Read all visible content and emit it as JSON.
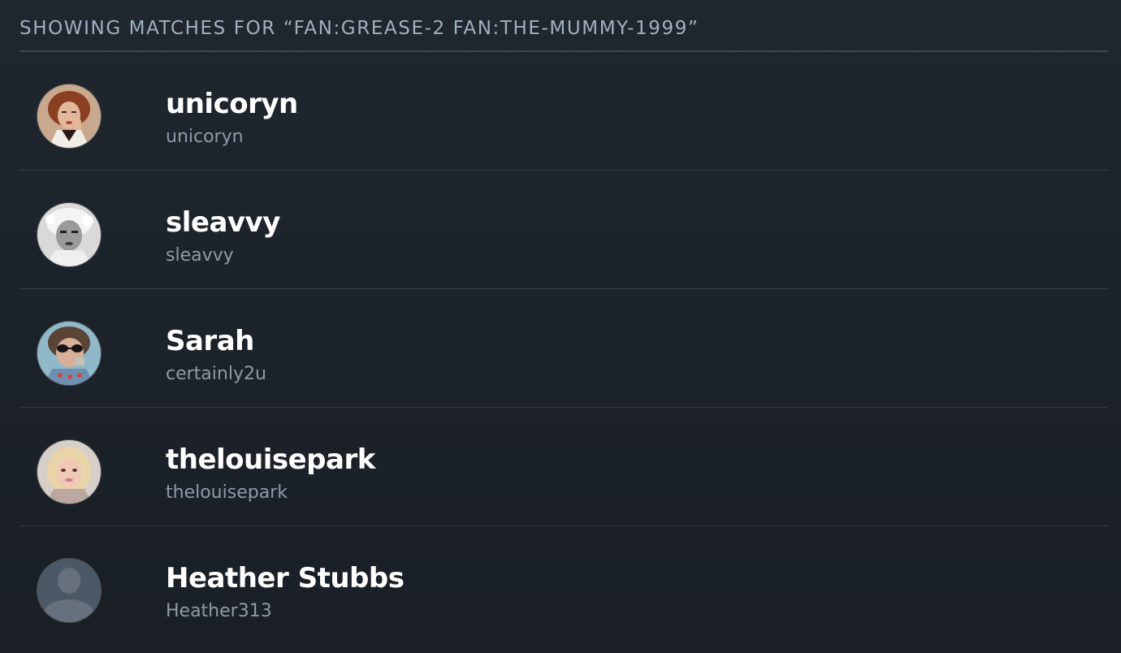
{
  "search": {
    "heading": "SHOWING MATCHES FOR “FAN:GREASE-2 FAN:THE-MUMMY-1999”"
  },
  "users": [
    {
      "display_name": "unicoryn",
      "username": "unicoryn",
      "avatar": "photo-avatar"
    },
    {
      "display_name": "sleavvy",
      "username": "sleavvy",
      "avatar": "photo-avatar"
    },
    {
      "display_name": "Sarah",
      "username": "certainly2u",
      "avatar": "photo-avatar"
    },
    {
      "display_name": "thelouisepark",
      "username": "thelouisepark",
      "avatar": "photo-avatar"
    },
    {
      "display_name": "Heather Stubbs",
      "username": "Heather313",
      "avatar": "default-avatar-icon"
    }
  ],
  "colors": {
    "background": "#1c2229",
    "heading_text": "#9fb1c1",
    "divider": "#333c46",
    "display_name": "#ffffff",
    "username": "#8d9ba9"
  }
}
